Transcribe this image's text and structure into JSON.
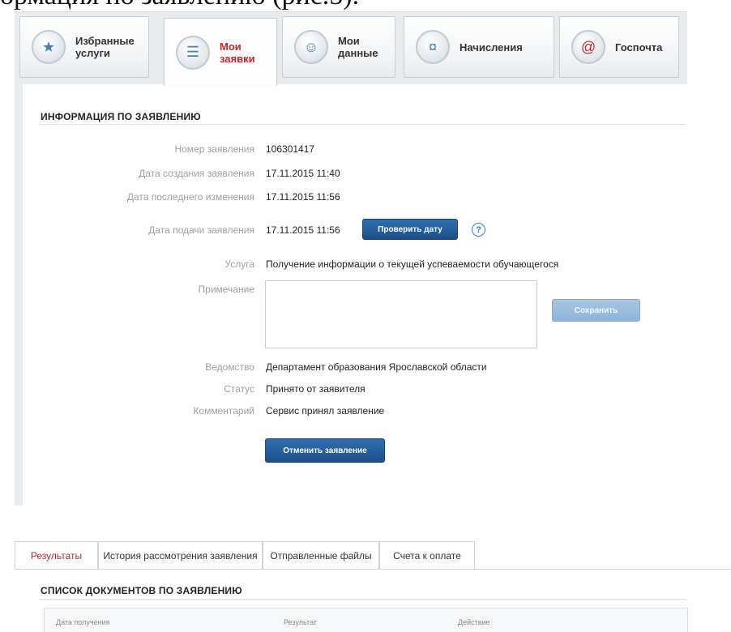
{
  "top_text": "ормация по заявлению (рис.5).",
  "tabs": [
    {
      "label": "Избранные услуги",
      "icon": "star-list-icon"
    },
    {
      "label": "Мои заявки",
      "icon": "document-list-icon"
    },
    {
      "label": "Мои данные",
      "icon": "user-card-icon"
    },
    {
      "label": "Начисления",
      "icon": "coins-icon"
    },
    {
      "label": "Госпочта",
      "icon": "mail-at-icon"
    }
  ],
  "info": {
    "title": "ИНФОРМАЦИЯ ПО ЗАЯВЛЕНИЮ",
    "rows": {
      "number": {
        "label": "Номер заявления",
        "value": "106301417"
      },
      "created": {
        "label": "Дата создания заявления",
        "value": "17.11.2015 11:40"
      },
      "changed": {
        "label": "Дата последнего изменения",
        "value": "17.11.2015 11:56"
      },
      "submitted": {
        "label": "Дата подачи заявления",
        "value": "17.11.2015 11:56"
      },
      "service": {
        "label": "Услуга",
        "value": "Получение информации о текущей успеваемости обучающегося"
      },
      "note": {
        "label": "Примечание",
        "value": ""
      },
      "agency": {
        "label": "Ведомство",
        "value": "Департамент образования Ярославской области"
      },
      "status": {
        "label": "Статус",
        "value": "Принято от заявителя"
      },
      "comment": {
        "label": "Комментарий",
        "value": "Сервис принял заявление"
      }
    },
    "check_date_button": "Проверить дату",
    "help_glyph": "?",
    "save_button": "Сохранить",
    "cancel_button": "Отменить заявление"
  },
  "lower_tabs": [
    "Результаты",
    "История рассмотрения заявления",
    "Отправленные файлы",
    "Счета к оплате"
  ],
  "documents": {
    "title": "СПИСОК ДОКУМЕНТОВ ПО ЗАЯВЛЕНИЮ",
    "columns": [
      "Дата получения",
      "Результат",
      "Действие"
    ]
  }
}
